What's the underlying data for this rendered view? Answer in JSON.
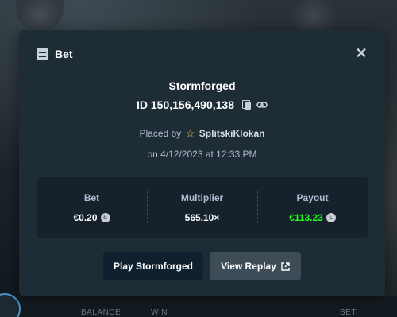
{
  "background": {
    "bottom_labels": [
      "BALANCE",
      "WIN",
      "BET"
    ]
  },
  "modal": {
    "title": "Bet",
    "title_icon": "bet-list-icon",
    "close_icon": "close-icon"
  },
  "bet": {
    "game_name": "Stormforged",
    "id_text": "ID 150,156,490,138",
    "placed_prefix": "Placed by",
    "user": "SplitskiKlokan",
    "date_text": "on 4/12/2023 at 12:33 PM"
  },
  "stats": {
    "bet_label": "Bet",
    "bet_value": "€0.20",
    "multiplier_label": "Multiplier",
    "multiplier_value": "565.10×",
    "payout_label": "Payout",
    "payout_value": "€113.23",
    "coin_symbol": "Ł"
  },
  "actions": {
    "play_label": "Play Stormforged",
    "replay_label": "View Replay"
  },
  "colors": {
    "payout_green": "#1fff20",
    "star_gold": "#f0c23a"
  }
}
